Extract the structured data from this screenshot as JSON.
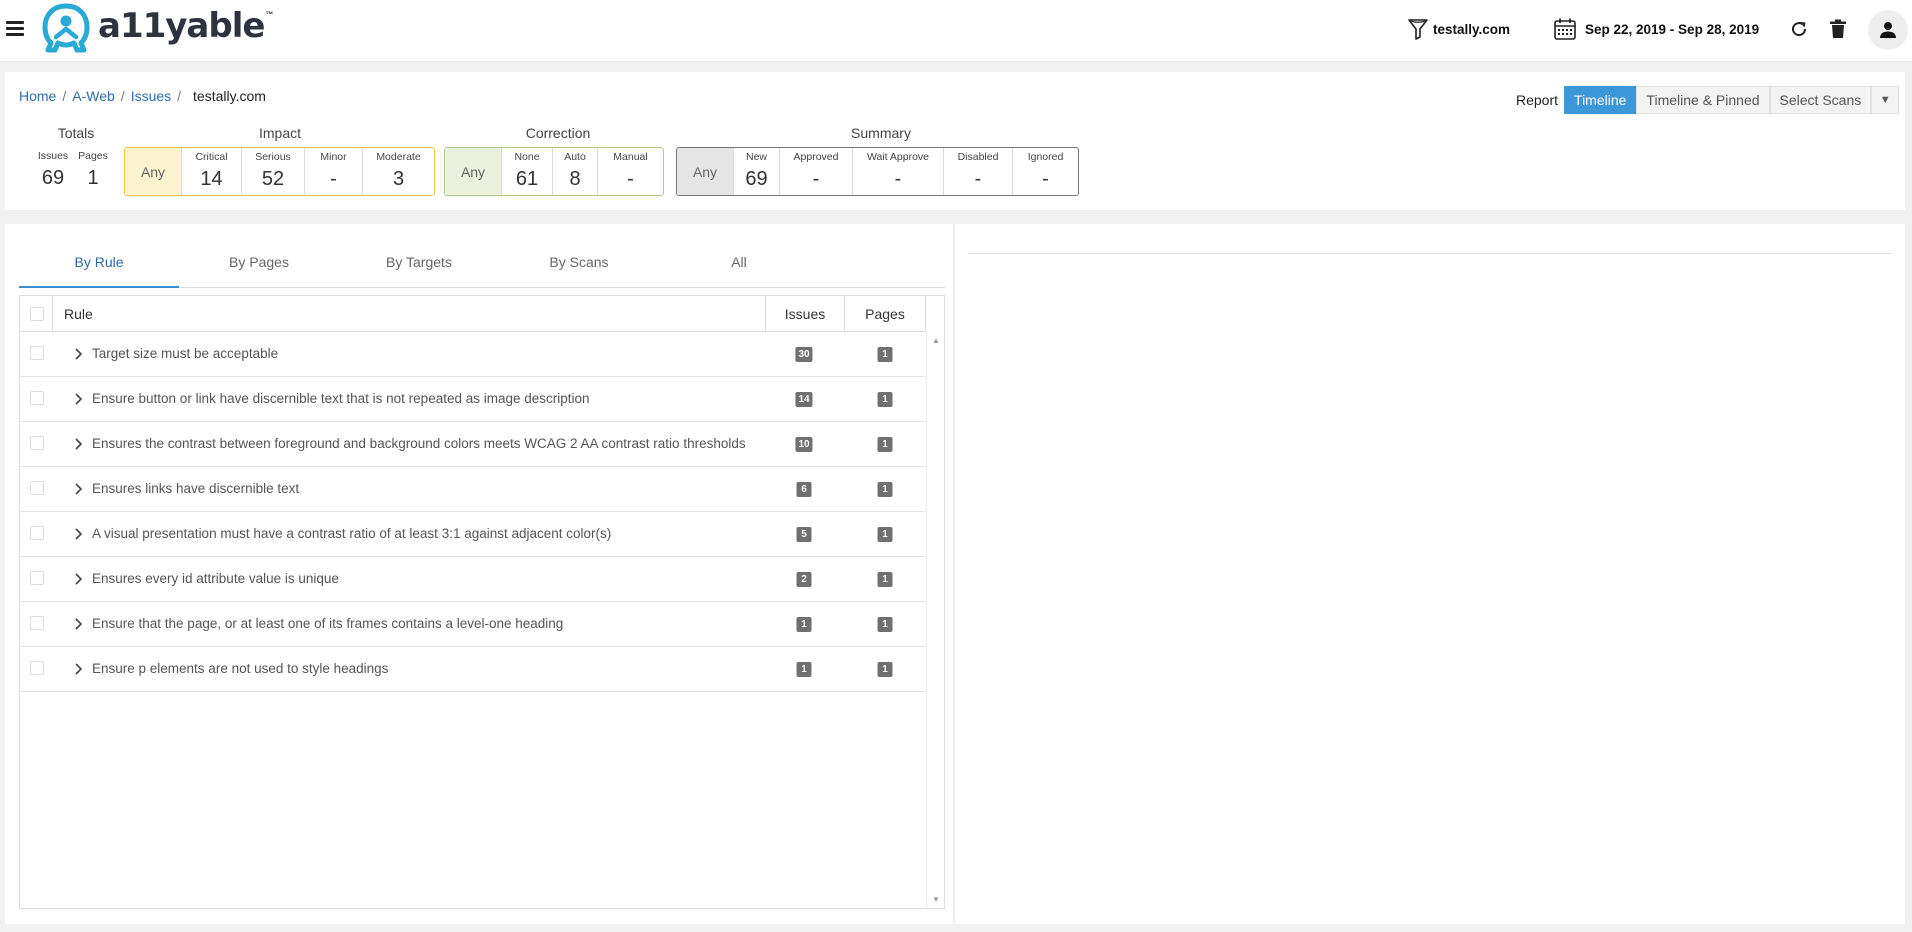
{
  "brand": {
    "name": "a11yable",
    "tm": "™"
  },
  "topbar": {
    "domain": "testally.com",
    "date_range": "Sep 22, 2019 - Sep 28, 2019"
  },
  "breadcrumb": {
    "home": "Home",
    "aweb": "A-Web",
    "issues": "Issues",
    "separator": "/",
    "current": "testally.com"
  },
  "totals": {
    "title": "Totals",
    "issues_label": "Issues",
    "issues": "69",
    "pages_label": "Pages",
    "pages": "1"
  },
  "impact": {
    "title": "Impact",
    "any": "Any",
    "items": [
      {
        "label": "Critical",
        "value": "14"
      },
      {
        "label": "Serious",
        "value": "52"
      },
      {
        "label": "Minor",
        "value": "-"
      },
      {
        "label": "Moderate",
        "value": "3"
      }
    ]
  },
  "correction": {
    "title": "Correction",
    "any": "Any",
    "items": [
      {
        "label": "None",
        "value": "61"
      },
      {
        "label": "Auto",
        "value": "8"
      },
      {
        "label": "Manual",
        "value": "-"
      }
    ]
  },
  "summary": {
    "title": "Summary",
    "any": "Any",
    "items": [
      {
        "label": "New",
        "value": "69"
      },
      {
        "label": "Approved",
        "value": "-"
      },
      {
        "label": "Wait Approve",
        "value": "-"
      },
      {
        "label": "Disabled",
        "value": "-"
      },
      {
        "label": "Ignored",
        "value": "-"
      }
    ]
  },
  "report": {
    "label": "Report",
    "timeline": "Timeline",
    "timeline_pinned": "Timeline & Pinned",
    "select_scans": "Select Scans",
    "caret": "▼",
    "active": "Timeline"
  },
  "tabs": [
    "By Rule",
    "By Pages",
    "By Targets",
    "By Scans",
    "All"
  ],
  "table": {
    "headers": {
      "rule": "Rule",
      "issues": "Issues",
      "pages": "Pages"
    },
    "rows": [
      {
        "rule": "Target size must be acceptable",
        "issues": "30",
        "pages": "1"
      },
      {
        "rule": "Ensure button or link have discernible text that is not repeated as image description",
        "issues": "14",
        "pages": "1"
      },
      {
        "rule": "Ensures the contrast between foreground and background colors meets WCAG 2 AA contrast ratio thresholds",
        "issues": "10",
        "pages": "1"
      },
      {
        "rule": "Ensures links have discernible text",
        "issues": "6",
        "pages": "1"
      },
      {
        "rule": "A visual presentation must have a contrast ratio of at least 3:1 against adjacent color(s)",
        "issues": "5",
        "pages": "1"
      },
      {
        "rule": "Ensures every id attribute value is unique",
        "issues": "2",
        "pages": "1"
      },
      {
        "rule": "Ensure that the page, or at least one of its frames contains a level-one heading",
        "issues": "1",
        "pages": "1"
      },
      {
        "rule": "Ensure p elements are not used to style headings",
        "issues": "1",
        "pages": "1"
      }
    ]
  },
  "colors": {
    "accent": "#3c97d8",
    "link": "#2b6cb0",
    "impact_border": "#e9c64b",
    "correction_border": "#b3c98e",
    "badge": "#707070"
  }
}
